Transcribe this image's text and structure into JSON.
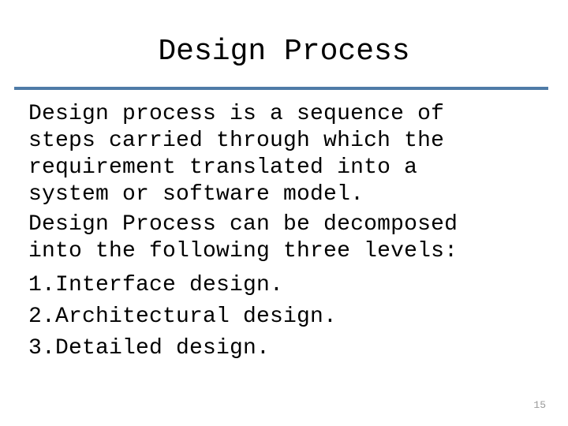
{
  "slide": {
    "title": "Design Process",
    "divider_color": "#4f7ba7",
    "background_color": "#ffffff",
    "text_color": "#000000",
    "paragraphs": [
      {
        "lines": [
          "Design process is a sequence of",
          "steps carried through which the",
          "requirement translated into a",
          "system or software model."
        ]
      },
      {
        "lines": [
          "Design Process can be decomposed",
          "into the following three levels:"
        ]
      }
    ],
    "list": [
      "1.Interface design.",
      "2.Architectural design.",
      "3.Detailed design."
    ],
    "page_number": "15",
    "page_number_color": "#9a9a9a"
  }
}
